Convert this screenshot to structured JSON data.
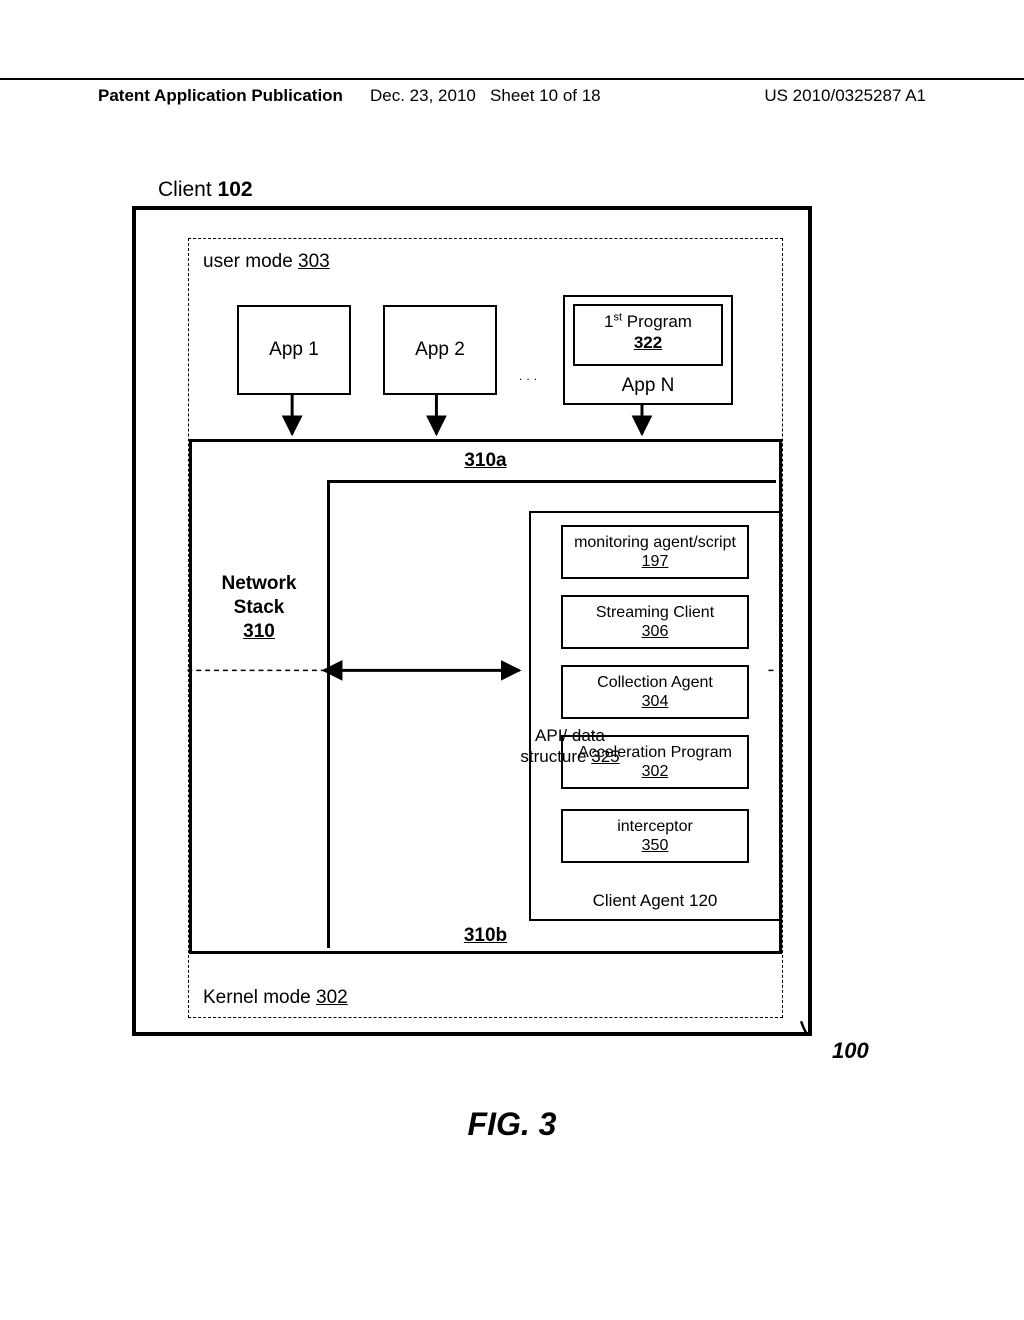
{
  "header": {
    "left": "Patent Application Publication",
    "mid_date": "Dec. 23, 2010",
    "mid_sheet": "Sheet 10 of 18",
    "right": "US 2010/0325287 A1"
  },
  "labels": {
    "client_prefix": "Client ",
    "client_ref": "102",
    "user_mode_prefix": "user  mode ",
    "user_mode_ref": "303",
    "kernel_mode_prefix": "Kernel mode ",
    "kernel_mode_ref": "302",
    "app1": "App 1",
    "app2": "App 2",
    "dots": "...",
    "first_program_line": "1  Program",
    "first_program_sup": "st",
    "first_program_ref": "322",
    "appn": "App N",
    "ref_310a": "310a",
    "ref_310b": "310b",
    "network_stack": "Network Stack",
    "network_stack_ref": "310",
    "api_line1": "API/ data",
    "api_line2_prefix": "structure ",
    "api_ref": "325",
    "client_agent_label": "Client Agent 120",
    "agent_items": {
      "monitoring": "monitoring agent/script",
      "monitoring_ref": "197",
      "streaming": "Streaming Client",
      "streaming_ref": "306",
      "collection": "Collection Agent",
      "collection_ref": "304",
      "accel": "Acceleration Program",
      "accel_ref": "302",
      "interceptor": "interceptor",
      "interceptor_ref": "350"
    },
    "corner_ref": "100",
    "figure": "FIG. 3"
  }
}
